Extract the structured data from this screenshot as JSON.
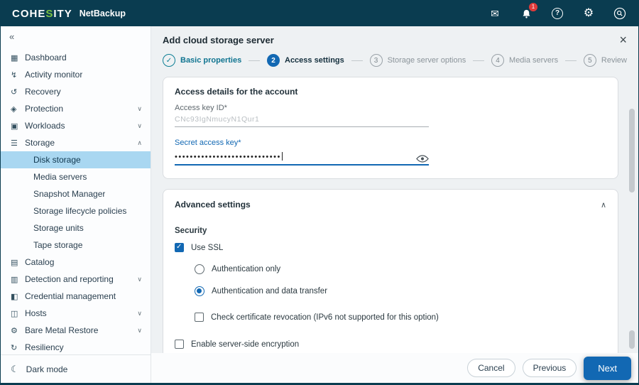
{
  "topbar": {
    "logo_pre": "COHE",
    "logo_s": "S",
    "logo_post": "ITY",
    "product": "NetBackup",
    "mail_glyph": "✉",
    "help_glyph": "?",
    "gear_glyph": "⚙",
    "notification_count": "1"
  },
  "sidebar": {
    "collapse_glyph": "«",
    "items": [
      {
        "glyph": "▦",
        "label": "Dashboard"
      },
      {
        "glyph": "↯",
        "label": "Activity monitor"
      },
      {
        "glyph": "↺",
        "label": "Recovery"
      },
      {
        "glyph": "◈",
        "label": "Protection",
        "chevron": "∨"
      },
      {
        "glyph": "▣",
        "label": "Workloads",
        "chevron": "∨"
      },
      {
        "glyph": "☰",
        "label": "Storage",
        "chevron": "∧"
      },
      {
        "label": "Disk storage"
      },
      {
        "label": "Media servers"
      },
      {
        "label": "Snapshot Manager"
      },
      {
        "label": "Storage lifecycle policies"
      },
      {
        "label": "Storage units"
      },
      {
        "label": "Tape storage"
      },
      {
        "glyph": "▤",
        "label": "Catalog"
      },
      {
        "glyph": "▥",
        "label": "Detection and reporting",
        "chevron": "∨"
      },
      {
        "glyph": "◧",
        "label": "Credential management"
      },
      {
        "glyph": "◫",
        "label": "Hosts",
        "chevron": "∨"
      },
      {
        "glyph": "⚙",
        "label": "Bare Metal Restore",
        "chevron": "∨"
      },
      {
        "glyph": "↻",
        "label": "Resiliency"
      }
    ],
    "dark_mode": {
      "glyph": "☾",
      "label": "Dark mode"
    }
  },
  "page": {
    "title": "Add cloud storage server",
    "close_glyph": "×",
    "stepper": [
      {
        "num": "1",
        "check": "✓",
        "label": "Basic properties",
        "state": "done"
      },
      {
        "num": "2",
        "label": "Access settings",
        "state": "active"
      },
      {
        "num": "3",
        "label": "Storage server options",
        "state": "pending"
      },
      {
        "num": "4",
        "label": "Media servers",
        "state": "pending"
      },
      {
        "num": "5",
        "label": "Review",
        "state": "pending"
      }
    ],
    "access_card": {
      "title": "Access details for the account",
      "access_key_label": "Access key ID*",
      "access_key_value": "CNc93IgNmucyN1Qur1",
      "secret_key_label": "Secret access key*",
      "secret_key_value": "••••••••••••••••••••••••••••"
    },
    "advanced_card": {
      "title": "Advanced settings",
      "collapse_glyph": "∧",
      "security_title": "Security",
      "use_ssl_label": "Use SSL",
      "auth_only_label": "Authentication only",
      "auth_data_label": "Authentication and data transfer",
      "cert_label": "Check certificate revocation (IPv6 not supported for this option)",
      "sse_label": "Enable server-side encryption"
    },
    "footer": {
      "cancel": "Cancel",
      "previous": "Previous",
      "next": "Next"
    }
  },
  "colors": {
    "topbar_bg": "#0a3c50",
    "accent_blue": "#1268b3",
    "done_teal": "#0e7f95",
    "selected_bg": "#a9d7f1",
    "badge_red": "#e03a3a",
    "logo_green": "#7ac143"
  }
}
